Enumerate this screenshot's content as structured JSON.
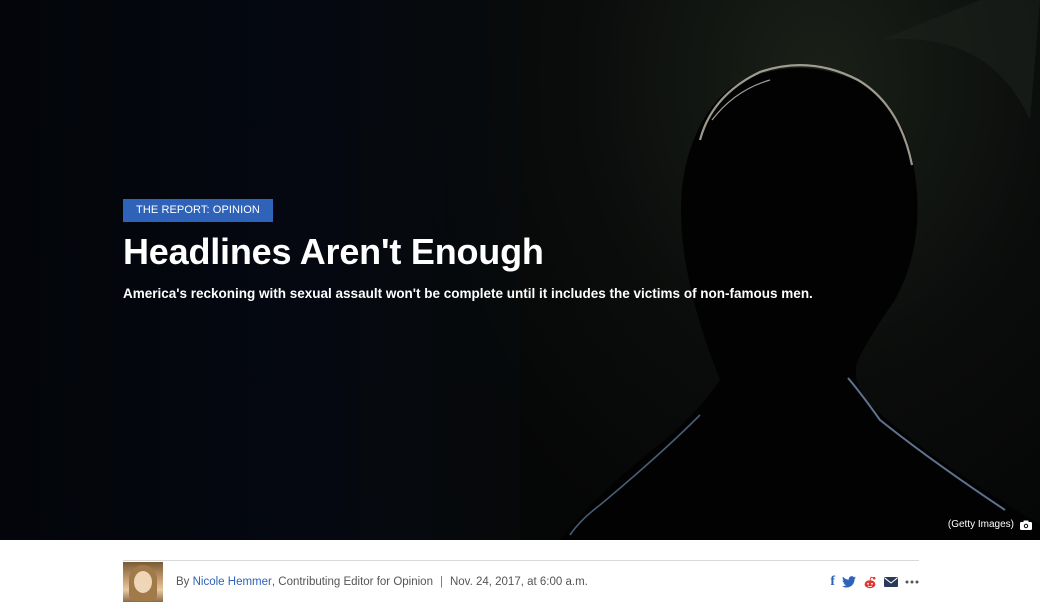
{
  "hero": {
    "section_label": "THE REPORT: OPINION",
    "headline": "Headlines Aren't Enough",
    "dek": "America's reckoning with sexual assault won't be complete until it includes the victims of non-famous men.",
    "image_credit": "(Getty Images)"
  },
  "byline": {
    "prefix": "By",
    "author": "Nicole Hemmer",
    "role": ", Contributing Editor for Opinion",
    "separator": "|",
    "date": "Nov. 24, 2017, at 6:00 a.m."
  },
  "share": {
    "icons": [
      "facebook-icon",
      "twitter-icon",
      "reddit-icon",
      "email-icon",
      "more-icon"
    ],
    "facebook_glyph": "f"
  },
  "colors": {
    "accent": "#2f63b9",
    "badge": "#2f63b9"
  }
}
